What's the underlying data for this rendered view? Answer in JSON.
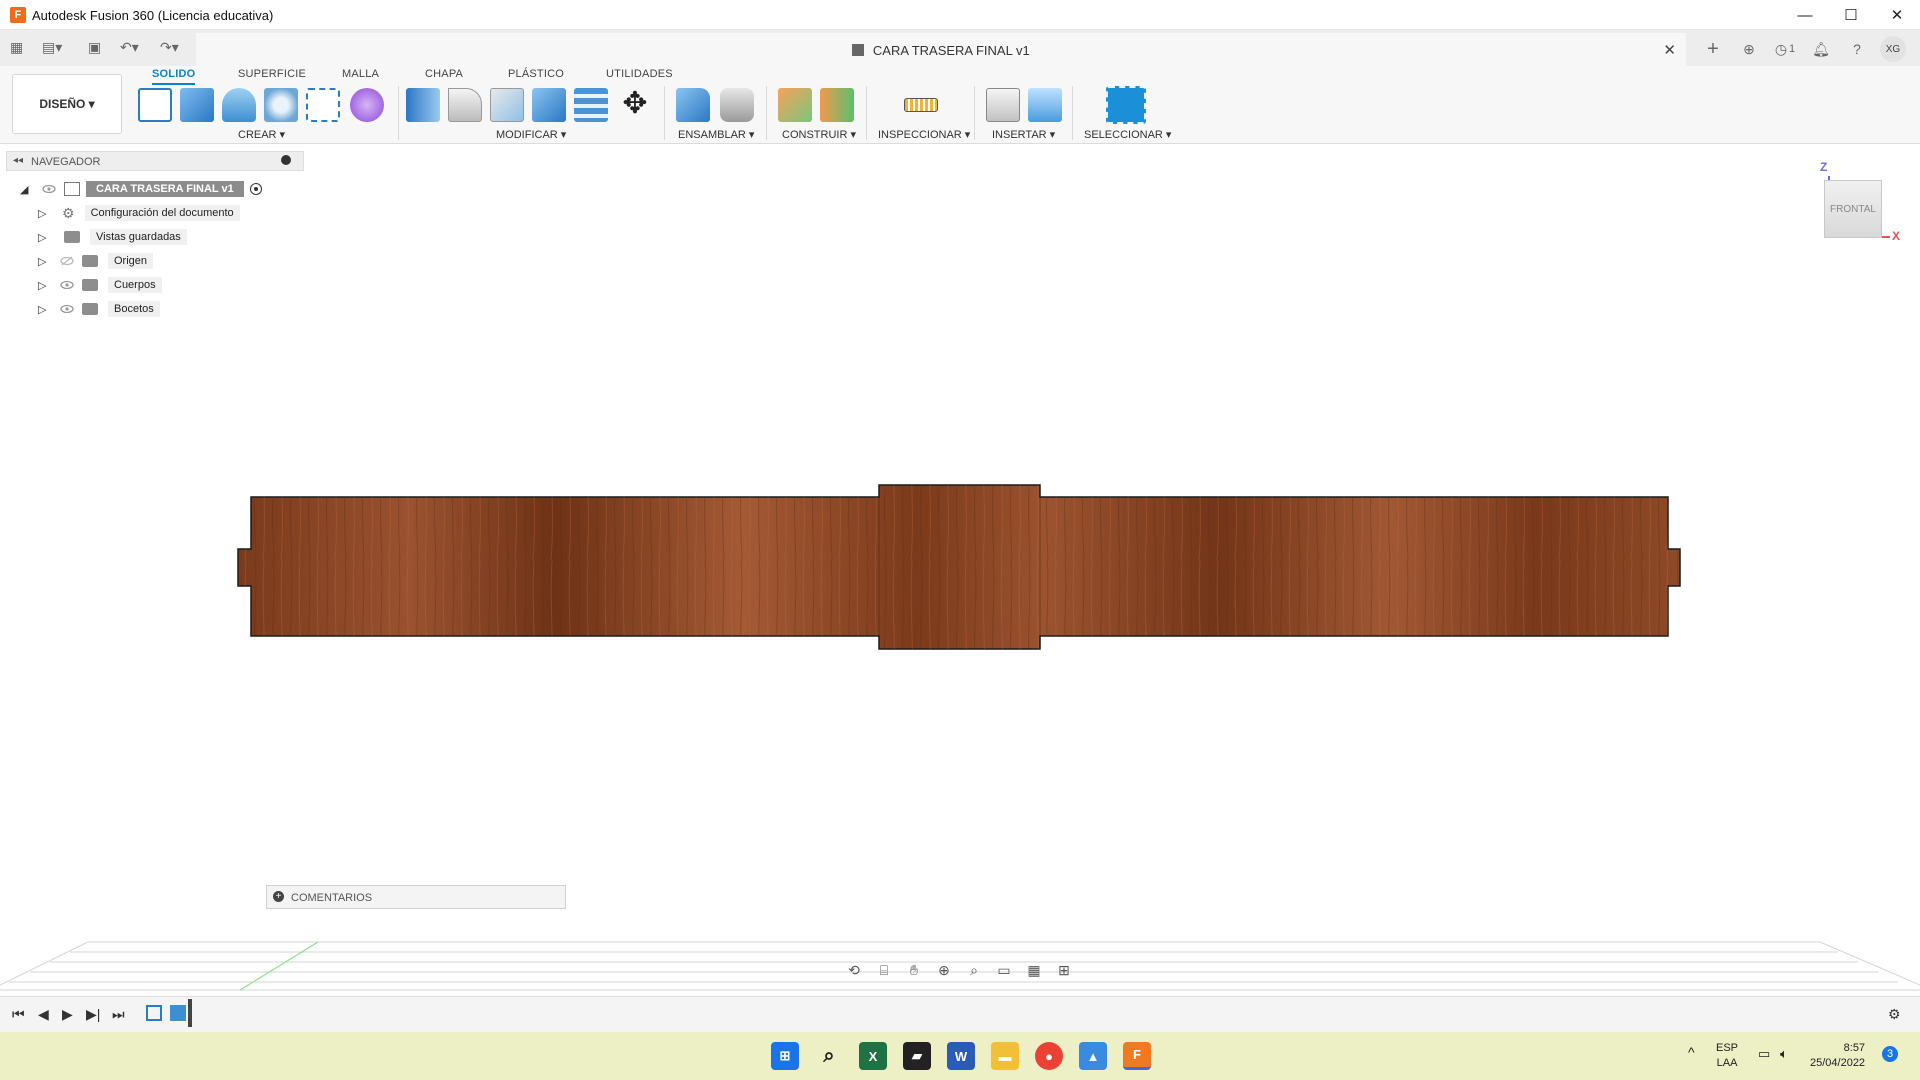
{
  "window": {
    "title": "Autodesk Fusion 360 (Licencia educativa)",
    "minimize": "—",
    "maximize": "☐",
    "close": "✕"
  },
  "document": {
    "tab_title": "CARA TRASERA FINAL v1",
    "close": "✕",
    "jobs_count": "1",
    "user_initials": "XG"
  },
  "toolbar": {
    "workspace": "DISEÑO ▾",
    "tabs": [
      "SOLIDO",
      "SUPERFICIE",
      "MALLA",
      "CHAPA",
      "PLÁSTICO",
      "UTILIDADES"
    ],
    "groups": [
      "CREAR ▾",
      "MODIFICAR ▾",
      "ENSAMBLAR ▾",
      "CONSTRUIR ▾",
      "INSPECCIONAR ▾",
      "INSERTAR ▾",
      "SELECCIONAR ▾"
    ]
  },
  "navigator": {
    "title": "NAVEGADOR",
    "root": "CARA TRASERA  FINAL v1",
    "items": [
      {
        "label": "Configuración del documento",
        "icon": "gear-icon"
      },
      {
        "label": "Vistas guardadas",
        "icon": "folder-icon"
      },
      {
        "label": "Origen",
        "icon": "folder-icon"
      },
      {
        "label": "Cuerpos",
        "icon": "folder-icon"
      },
      {
        "label": "Bocetos",
        "icon": "folder-icon"
      }
    ]
  },
  "viewcube": {
    "face": "FRONTAL",
    "axis_z": "Z",
    "axis_x": "X"
  },
  "comments": {
    "label": "COMENTARIOS"
  },
  "taskbar": {
    "lang_top": "ESP",
    "lang_bottom": "LAA",
    "time": "8:57",
    "date": "25/04/2022",
    "notifications": "3"
  },
  "colors": {
    "accent": "#0b82c8",
    "wood": "#8a4423",
    "taskbar": "#ecf0c4"
  }
}
